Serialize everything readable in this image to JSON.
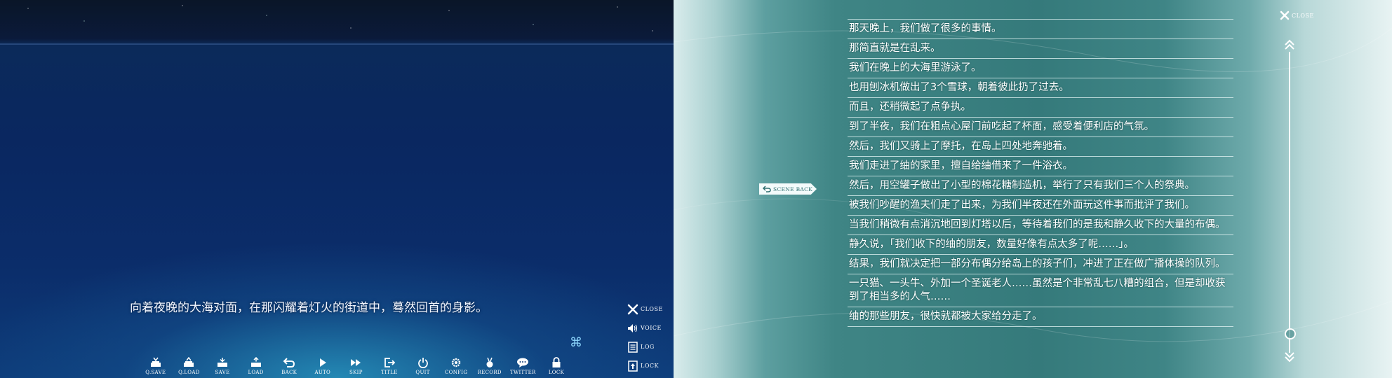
{
  "game": {
    "dialogue": "向着夜晚的大海对面，在那闪耀着灯火的街道中，蓦然回首的身影。",
    "side_menu": [
      {
        "label": "CLOSE",
        "icon": "close-icon"
      },
      {
        "label": "VOICE",
        "icon": "speaker-icon"
      },
      {
        "label": "LOG",
        "icon": "document-icon"
      },
      {
        "label": "LOCK",
        "icon": "lock-icon"
      }
    ],
    "quick_menu": [
      {
        "label": "Q.SAVE",
        "icon": "quick-save-icon"
      },
      {
        "label": "Q.LOAD",
        "icon": "quick-load-icon"
      },
      {
        "label": "SAVE",
        "icon": "save-icon"
      },
      {
        "label": "LOAD",
        "icon": "load-icon"
      },
      {
        "label": "BACK",
        "icon": "back-arrow-icon"
      },
      {
        "label": "AUTO",
        "icon": "play-icon"
      },
      {
        "label": "SKIP",
        "icon": "fast-forward-icon"
      },
      {
        "label": "TITLE",
        "icon": "exit-icon"
      },
      {
        "label": "QUIT",
        "icon": "power-icon"
      },
      {
        "label": "CONFIG",
        "icon": "gear-icon"
      },
      {
        "label": "RECORD",
        "icon": "medal-icon"
      },
      {
        "label": "TWITTER",
        "icon": "speech-bubble-icon"
      },
      {
        "label": "LOCK",
        "icon": "lock-icon"
      }
    ]
  },
  "backlog": {
    "close_label": "CLOSE",
    "scene_back_label": "SCENE BACK",
    "lines": [
      "那天晚上，我们做了很多的事情。",
      "那简直就是在乱来。",
      "我们在晚上的大海里游泳了。",
      "也用刨冰机做出了3个雪球，朝着彼此扔了过去。",
      "而且，还稍微起了点争执。",
      "到了半夜，我们在粗点心屋门前吃起了杯面，感受着便利店的气氛。",
      "然后，我们又骑上了摩托，在岛上四处地奔驰着。",
      "我们走进了䌷的家里，擅自给䌷借来了一件浴衣。",
      "然后，用空罐子做出了小型的棉花糖制造机，举行了只有我们三个人的祭典。",
      "被我们吵醒的渔夫们走了出来，为我们半夜还在外面玩这件事而批评了我们。",
      "当我们稍微有点消沉地回到灯塔以后，等待着我们的是我和静久收下的大量的布偶。",
      "静久说，「我们收下的䌷的朋友，数量好像有点太多了呢……」。",
      "结果，我们就决定把一部分布偶分给岛上的孩子们，冲进了正在做广播体操的队列。",
      "一只猫、一头牛、外加一个圣诞老人……虽然是个非常乱七八糟的组合，但是却收获到了相当多的人气……",
      "䌷的那些朋友，很快就都被大家给分走了。"
    ],
    "scroll_position": 0.95
  }
}
